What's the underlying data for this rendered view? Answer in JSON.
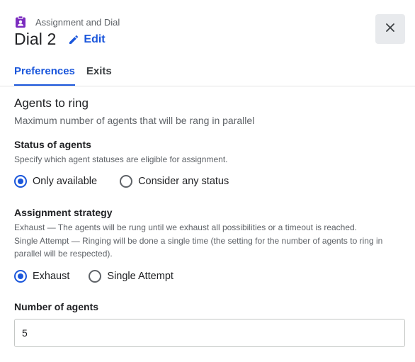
{
  "header": {
    "kicker": "Assignment and Dial",
    "title": "Dial 2",
    "edit_label": "Edit"
  },
  "tabs": [
    {
      "label": "Preferences",
      "active": true
    },
    {
      "label": "Exits",
      "active": false
    }
  ],
  "agents_to_ring": {
    "title": "Agents to ring",
    "subtitle": "Maximum number of agents that will be rang in parallel"
  },
  "status_of_agents": {
    "label": "Status of agents",
    "description": "Specify which agent statuses are eligible for assignment.",
    "options": [
      {
        "label": "Only available",
        "checked": true
      },
      {
        "label": "Consider any status",
        "checked": false
      }
    ]
  },
  "assignment_strategy": {
    "label": "Assignment strategy",
    "description_line1": "Exhaust — The agents will be rung until we exhaust all possibilities or a timeout is reached.",
    "description_line2": "Single Attempt — Ringing will be done a single time (the setting for the number of agents to ring in parallel will be respected).",
    "options": [
      {
        "label": "Exhaust",
        "checked": true
      },
      {
        "label": "Single Attempt",
        "checked": false
      }
    ]
  },
  "number_of_agents": {
    "label": "Number of agents",
    "value": "5"
  },
  "colors": {
    "accent": "#1a56db",
    "kicker_icon": "#7b2cbf"
  },
  "icons": {
    "kicker": "clipboard-account-icon",
    "edit": "pencil-icon",
    "close": "close-icon"
  }
}
